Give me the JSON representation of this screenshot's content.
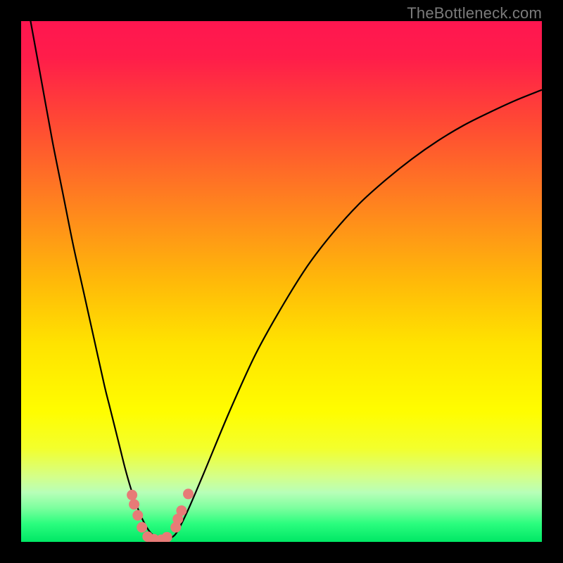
{
  "watermark": "TheBottleneck.com",
  "colors": {
    "frame": "#000000",
    "watermark": "#7b7b7b",
    "curve": "#000000",
    "marker": "#e77b77",
    "gradient_stops": [
      {
        "offset": 0.0,
        "color": "#ff1650"
      },
      {
        "offset": 0.07,
        "color": "#ff1d4a"
      },
      {
        "offset": 0.2,
        "color": "#ff4b33"
      },
      {
        "offset": 0.35,
        "color": "#ff821f"
      },
      {
        "offset": 0.5,
        "color": "#ffb909"
      },
      {
        "offset": 0.62,
        "color": "#ffe300"
      },
      {
        "offset": 0.75,
        "color": "#fffd00"
      },
      {
        "offset": 0.82,
        "color": "#f3ff2c"
      },
      {
        "offset": 0.875,
        "color": "#d4ff8a"
      },
      {
        "offset": 0.905,
        "color": "#b8ffb8"
      },
      {
        "offset": 0.935,
        "color": "#7cff9e"
      },
      {
        "offset": 0.965,
        "color": "#2bfd7e"
      },
      {
        "offset": 1.0,
        "color": "#00e765"
      }
    ]
  },
  "chart_data": {
    "type": "line",
    "title": "",
    "xlabel": "",
    "ylabel": "",
    "xlim": [
      0,
      100
    ],
    "ylim": [
      0,
      100
    ],
    "series": [
      {
        "name": "bottleneck-curve",
        "x": [
          0,
          2,
          4,
          6,
          8,
          10,
          12,
          14,
          16,
          17,
          18,
          19,
          20,
          21,
          22,
          23,
          24,
          25,
          26,
          27,
          28,
          29,
          30,
          32,
          35,
          40,
          45,
          50,
          55,
          60,
          65,
          70,
          75,
          80,
          85,
          90,
          95,
          100
        ],
        "y": [
          110,
          99,
          88,
          77,
          67,
          57,
          48,
          39,
          30,
          26,
          22,
          18,
          14,
          10.5,
          7.5,
          5,
          3,
          1.6,
          0.8,
          0.4,
          0.4,
          0.9,
          2,
          6,
          13,
          25,
          36,
          45,
          53,
          59.5,
          65,
          69.5,
          73.5,
          77,
          80,
          82.5,
          84.8,
          86.8
        ]
      }
    ],
    "markers": [
      {
        "x": 21.3,
        "y": 9.0
      },
      {
        "x": 21.7,
        "y": 7.2
      },
      {
        "x": 22.4,
        "y": 5.1
      },
      {
        "x": 23.2,
        "y": 2.8
      },
      {
        "x": 24.3,
        "y": 1.0
      },
      {
        "x": 25.5,
        "y": 0.5
      },
      {
        "x": 26.9,
        "y": 0.4
      },
      {
        "x": 28.0,
        "y": 0.9
      },
      {
        "x": 29.7,
        "y": 2.8
      },
      {
        "x": 30.1,
        "y": 4.4
      },
      {
        "x": 30.8,
        "y": 6.0
      },
      {
        "x": 32.1,
        "y": 9.2
      }
    ]
  }
}
